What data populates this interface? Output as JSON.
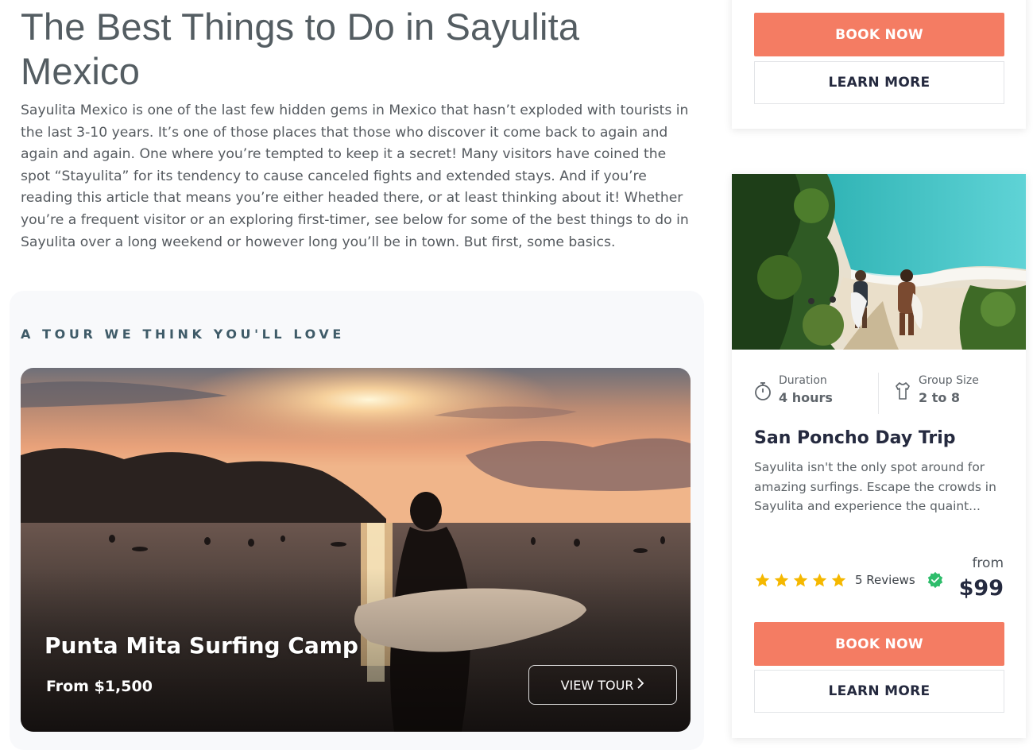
{
  "article": {
    "title": "The Best Things to Do in Sayulita Mexico",
    "intro": "Sayulita Mexico is one of the last few hidden gems in Mexico that hasn’t exploded with tourists in the last 3-10 years. It’s one of those places that those who discover it come back to again and again and again. One where you’re tempted to keep it a secret! Many visitors have coined the spot “Stayulita” for its tendency to cause canceled fights and extended stays. And if you’re reading this article that means you’re either headed there, or at least thinking about it! Whether you’re a frequent visitor or an exploring first-timer, see below for some of the best things to do in Sayulita over a long weekend or however long you’ll be in town. But first, some basics."
  },
  "featured": {
    "heading": "A TOUR WE THINK YOU'LL LOVE",
    "tour_title": "Punta Mita Surfing Camp",
    "price": "From $1,500",
    "cta_label": "VIEW TOUR",
    "cta_icon": "chevron-right-icon"
  },
  "sidebar": {
    "top_card": {
      "book_label": "BOOK NOW",
      "learn_label": "LEARN MORE"
    },
    "tour_card": {
      "image": "beach-surfers-photo",
      "duration_label": "Duration",
      "duration_value": "4 hours",
      "duration_icon": "stopwatch-icon",
      "group_label": "Group Size",
      "group_value": "2 to 8",
      "group_icon": "shirt-icon",
      "name": "San Poncho Day Trip",
      "description": "Sayulita isn't the only spot around for amazing surfings. Escape the crowds in Sayulita and experience the quaint...",
      "rating": 5,
      "reviews": "5 Reviews",
      "price_prefix": "from",
      "price": "$99",
      "book_label": "BOOK NOW",
      "learn_label": "LEARN MORE"
    }
  },
  "colors": {
    "accent": "#f47c63",
    "heading": "#3f5b68",
    "dark": "#252a3f",
    "star": "#f5b800",
    "verified": "#2ebd6b"
  }
}
